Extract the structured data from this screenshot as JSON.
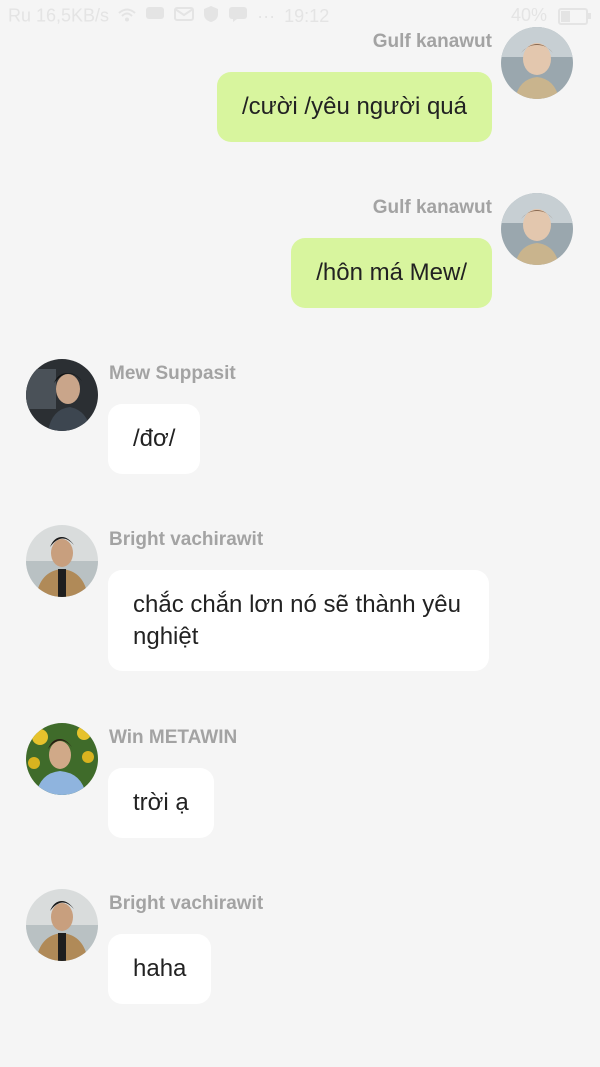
{
  "status_bar": {
    "left_text": "Ru 16,5KB/s",
    "time": "19:12",
    "battery": "40%",
    "battery_level": 0.4,
    "icons": [
      "wifi-icon",
      "message-icon",
      "mail-icon",
      "shield-icon",
      "chat-icon",
      "more-icon"
    ]
  },
  "messages": [
    {
      "sender": "Gulf kanawut",
      "text": "/cười /yêu người quá",
      "side": "right",
      "bubble_color": "#d8f59e"
    },
    {
      "sender": "Gulf kanawut",
      "text": "/hôn má Mew/",
      "side": "right",
      "bubble_color": "#d8f59e"
    },
    {
      "sender": "Mew Suppasit",
      "text": "/đơ/",
      "side": "left",
      "bubble_color": "#ffffff"
    },
    {
      "sender": "Bright vachirawit",
      "text": "chắc chắn lơn nó sẽ thành yêu nghiệt",
      "side": "left",
      "bubble_color": "#ffffff"
    },
    {
      "sender": "Win METAWIN",
      "text": "trời ạ",
      "side": "left",
      "bubble_color": "#ffffff"
    },
    {
      "sender": "Bright vachirawit",
      "text": "haha",
      "side": "left",
      "bubble_color": "#ffffff"
    }
  ],
  "colors": {
    "background": "#f5f5f5",
    "sender_name": "#a3a3a3",
    "outgoing_bubble": "#d8f59e",
    "incoming_bubble": "#ffffff"
  }
}
